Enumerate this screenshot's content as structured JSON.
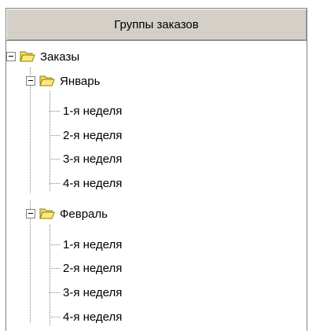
{
  "header": {
    "title": "Группы заказов"
  },
  "tree": {
    "root": {
      "label": "Заказы",
      "months": [
        {
          "label": "Январь",
          "weeks": [
            "1-я неделя",
            "2-я неделя",
            "3-я неделя",
            "4-я неделя"
          ]
        },
        {
          "label": "Февраль",
          "weeks": [
            "1-я неделя",
            "2-я неделя",
            "3-я неделя",
            "4-я неделя"
          ]
        }
      ]
    }
  },
  "icons": {
    "expander": "collapse-minus-icon",
    "folder": "open-folder-icon"
  },
  "colors": {
    "folder_fill": "#ffd966",
    "folder_stroke": "#808000",
    "header_bg": "#d4d0c8"
  }
}
